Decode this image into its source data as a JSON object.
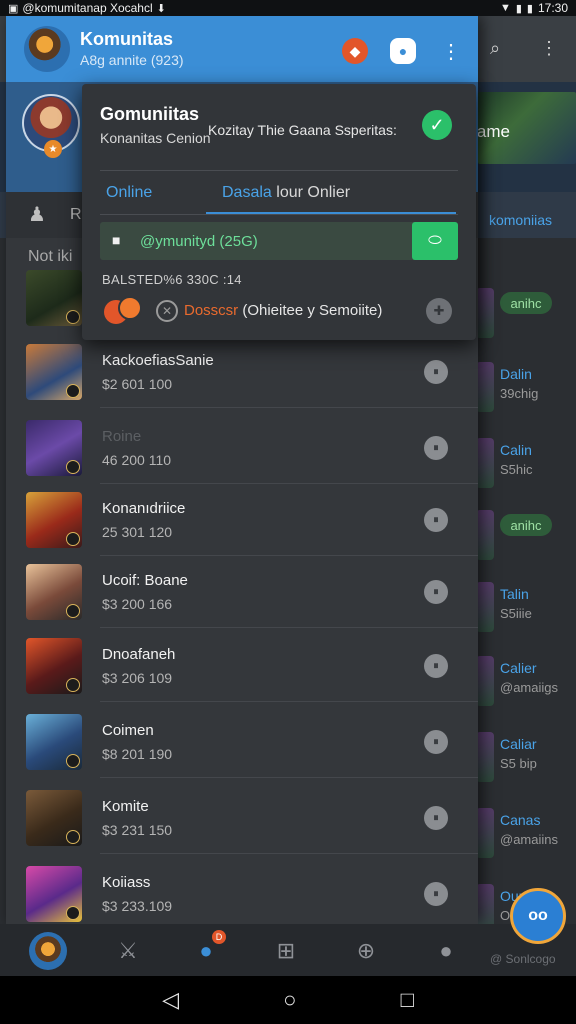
{
  "status_bar": {
    "left_text": "@komumitanap Xocahcl",
    "time": "17:30"
  },
  "background_app": {
    "banner_text": "ame",
    "tab_label": "komoniias",
    "rows": [
      {
        "line1": "anihc",
        "line2": "",
        "pill": true
      },
      {
        "line1": "Dalin",
        "line2": "39chig",
        "pill": false
      },
      {
        "line1": "Calin",
        "line2": "S5hic",
        "pill": false
      },
      {
        "line1": "anihc",
        "line2": "",
        "pill": true
      },
      {
        "line1": "Talin",
        "line2": "S5iiie",
        "pill": false
      },
      {
        "line1": "Calier",
        "line2": "@amaiigs",
        "pill": false
      },
      {
        "line1": "Caliar",
        "line2": "S5 bip",
        "pill": false
      },
      {
        "line1": "Canas",
        "line2": "@amaiins",
        "pill": false
      },
      {
        "line1": "Ounar",
        "line2": "Ode",
        "pill": false
      }
    ],
    "bottom_label": "@ Sonlcogo"
  },
  "drawer": {
    "title": "Komunitas",
    "subtitle": "A8g annite (923)",
    "quick_label": "R",
    "section_label": "Not iki",
    "games": [
      {
        "name": "",
        "price": "",
        "dim": false,
        "action": "⏸"
      },
      {
        "name": "KackoefiasSanie",
        "price": "$2 601 100",
        "dim": false,
        "action": "⏸"
      },
      {
        "name": "Roine",
        "price": "46 200 110",
        "dim": true,
        "action": "⏸"
      },
      {
        "name": "Konanıdriice",
        "price": "25 301 120",
        "dim": false,
        "action": "⏸"
      },
      {
        "name": "Ucoif: Boane",
        "price": "$3 200 166",
        "dim": false,
        "action": "⏸"
      },
      {
        "name": "Dnoafaneh",
        "price": "$3 206 109",
        "dim": false,
        "action": "⏸"
      },
      {
        "name": "Coimen",
        "price": "$8 201 190",
        "dim": false,
        "action": "⏸"
      },
      {
        "name": "Komite",
        "price": "$3 231 150",
        "dim": false,
        "action": "⏸"
      },
      {
        "name": "Koiiass",
        "price": "$3 233.109",
        "dim": false,
        "action": "⏸"
      }
    ]
  },
  "popup": {
    "title": "Gomuniitas",
    "subtitle": "Konanitas Cenion",
    "tag": "Kozitay Thie Gaana Ssperitas:",
    "tab_online": "Online",
    "tab_data_hl": "Dasala",
    "tab_data_rest": " lour Onlier",
    "invite_text": "@ymunityd (25G)",
    "stats": "BALSTED%6 330C :14",
    "desc_hl": "Dosscsr",
    "desc_rest": " (Ohieitee y Semoiite)"
  },
  "fab_label": "oo",
  "icons": {
    "check": "check-icon",
    "lock": "lock-icon",
    "link": "link-icon",
    "close": "close-icon",
    "gear": "gear-icon"
  }
}
